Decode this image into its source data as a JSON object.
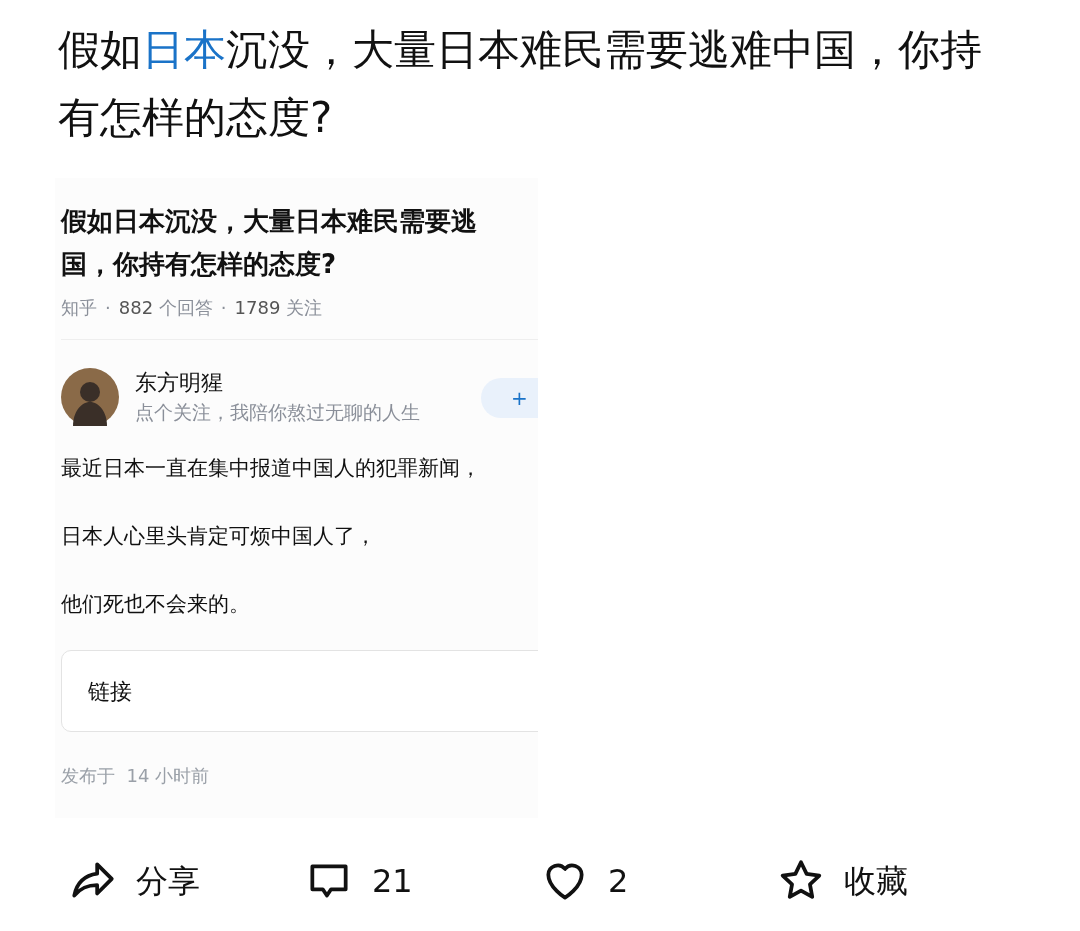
{
  "title": {
    "before": "假如",
    "link": "日本",
    "after": "沉没，大量日本难民需要逃难中国，你持有怎样的态度?"
  },
  "embedded": {
    "question": "假如日本沉没，大量日本难民需要逃",
    "question_line2": "国，你持有怎样的态度?",
    "meta_separator": "·",
    "meta": [
      {
        "kind": "source",
        "text": "知乎"
      },
      {
        "kind": "stat",
        "number": "882",
        "label": "个回答"
      },
      {
        "kind": "stat",
        "number": "1789",
        "label": "关注"
      }
    ],
    "author": {
      "name": "东方明猩",
      "bio": "点个关注，我陪你熬过无聊的人生",
      "follow_button": "+"
    },
    "paragraphs": [
      "最近日本一直在集中报道中国人的犯罪新闻，",
      "日本人心里头肯定可烦中国人了，",
      "他们死也不会来的。"
    ],
    "link_card": "链接",
    "published": {
      "label": "发布于",
      "time": "14 小时前"
    }
  },
  "actions": [
    {
      "kind": "share",
      "label": "分享"
    },
    {
      "kind": "comment",
      "label": "21"
    },
    {
      "kind": "like",
      "label": "2"
    },
    {
      "kind": "favorite",
      "label": "收藏"
    }
  ]
}
